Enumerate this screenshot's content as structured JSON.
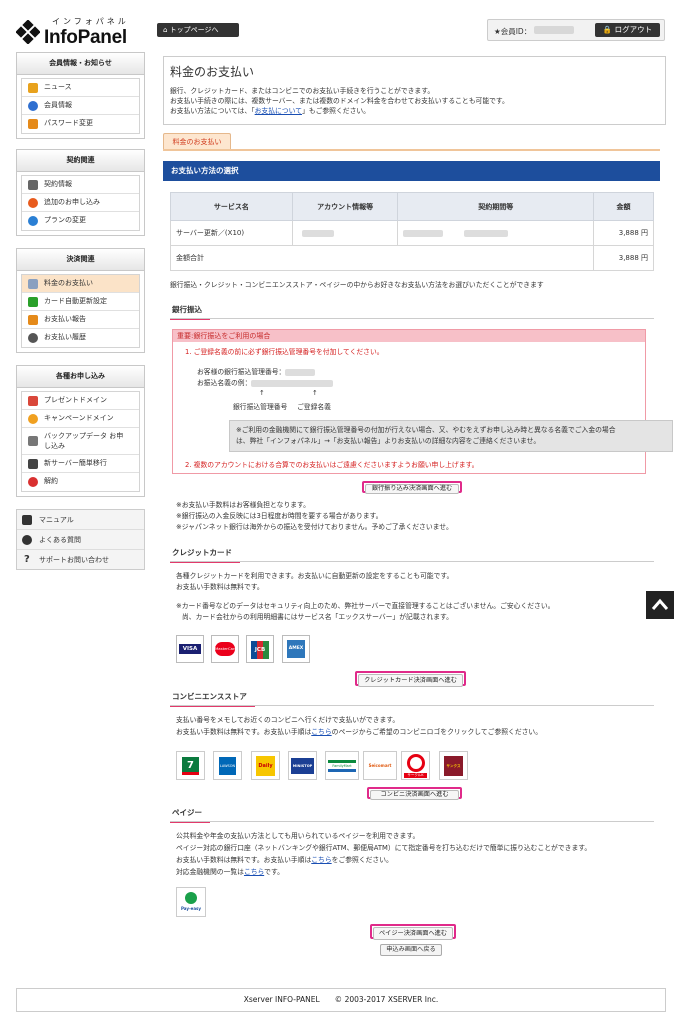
{
  "header": {
    "logo_kana": "インフォパネル",
    "logo_name": "InfoPanel",
    "toppage_button": "トップページへ",
    "member_id_label": "★会員ID：",
    "logout_button": "ログアウト"
  },
  "sidebar": {
    "groups": [
      {
        "title": "会員情報・お知らせ",
        "items": [
          {
            "label": "ニュース",
            "icon": "news-icon",
            "color": "#e8a21d"
          },
          {
            "label": "会員情報",
            "icon": "member-icon",
            "color": "#2f6fd0"
          },
          {
            "label": "パスワード変更",
            "icon": "password-icon",
            "color": "#e58a1a"
          }
        ]
      },
      {
        "title": "契約関連",
        "items": [
          {
            "label": "契約情報",
            "icon": "contract-icon",
            "color": "#666666"
          },
          {
            "label": "追加のお申し込み",
            "icon": "add-icon",
            "color": "#e85b1d"
          },
          {
            "label": "プランの変更",
            "icon": "plan-change-icon",
            "color": "#2a7fd4"
          }
        ]
      },
      {
        "title": "決済関連",
        "items": [
          {
            "label": "料金のお支払い",
            "icon": "payment-icon",
            "color": "#8aa0c0",
            "active": true
          },
          {
            "label": "カード自動更新設定",
            "icon": "card-icon",
            "color": "#2aa02a"
          },
          {
            "label": "お支払い報告",
            "icon": "report-icon",
            "color": "#e58a1a"
          },
          {
            "label": "お支払い履歴",
            "icon": "history-icon",
            "color": "#555555"
          }
        ]
      },
      {
        "title": "各種お申し込み",
        "items": [
          {
            "label": "プレゼントドメイン",
            "icon": "present-icon",
            "color": "#d9473a"
          },
          {
            "label": "キャンペーンドメイン",
            "icon": "campaign-icon",
            "color": "#f0a020"
          },
          {
            "label": "バックアップデータ お申し込み",
            "icon": "backup-icon",
            "color": "#777777"
          },
          {
            "label": "新サーバー簡単移行",
            "icon": "migration-icon",
            "color": "#444444"
          },
          {
            "label": "解約",
            "icon": "cancel-icon",
            "color": "#d93030"
          }
        ]
      }
    ],
    "links": [
      {
        "label": "マニュアル",
        "icon": "manual-icon"
      },
      {
        "label": "よくある質問",
        "icon": "faq-icon"
      },
      {
        "label": "サポートお問い合わせ",
        "icon": "support-icon"
      }
    ]
  },
  "main": {
    "title": "料金のお支払い",
    "intro_line1": "銀行、クレジットカード、またはコンビニでのお支払い手続きを行うことができます。",
    "intro_line2": "お支払い手続きの際には、複数サーバー、または複数のドメイン料金を合わせてお支払いすることも可能です。",
    "intro_line3_pre": "お支払い方法については、「",
    "intro_link": "お支払について",
    "intro_line3_post": "」もご参照ください。",
    "tab": "料金のお支払い",
    "section_bar": "お支払い方法の選択",
    "table": {
      "headers": [
        "サービス名",
        "アカウント情報等",
        "契約期間等",
        "金額"
      ],
      "row_service": "サーバー更新／(X10)",
      "row_amount": "3,888 円",
      "total_label": "金額合計",
      "total_amount": "3,888 円"
    },
    "select_text": "銀行振込・クレジット・コンビニエンスストア・ペイジーの中からお好きなお支払い方法をお選びいただくことができます",
    "bank": {
      "title": "銀行振込",
      "notice_head": "重要:銀行振込をご利用の場合",
      "item1": "1. ご登録名義の前に必ず銀行振込管理番号を付加してください。",
      "mgmt_label": "お客様の銀行振込管理番号：",
      "example_label": "お振込名義の例：",
      "arrow": "↑",
      "label_mgmt": "銀行振込管理番号",
      "label_name": "ご登録名義",
      "gray_line1": "※ご利用の金融機関にて銀行振込管理番号の付加が行えない場合、又、やむをえずお申し込み時と異なる名義でご入金の場合",
      "gray_line2": "は、弊社「インフォパネル」→「お支払い報告」よりお支払いの詳細な内容をご連絡くださいませ。",
      "item2": "2. 複数のアカウントにおける合算でのお支払いはご遠慮くださいますようお願い申し上げます。",
      "button": "銀行振り込み決済画面へ進む",
      "note1": "※お支払い手数料はお客様負担となります。",
      "note2": "※銀行振込の入金反映には3日程度お時間を要する場合があります。",
      "note3": "※ジャパンネット銀行は海外からの振込を受付けておりません。予めご了承くださいませ。"
    },
    "credit": {
      "title": "クレジットカード",
      "line1": "各種クレジットカードを利用できます。お支払いに自動更新の設定をすることも可能です。",
      "line2": "お支払い手数料は無料です。",
      "line3": "※カード番号などのデータはセキュリティ向上のため、弊社サーバーで直接管理することはございません。ご安心ください。",
      "line4": "尚、カード会社からの利用明細書にはサービス名「エックスサーバー」が記載されます。",
      "cards": [
        "VISA",
        "MasterCard",
        "JCB",
        "AMEX"
      ],
      "button": "クレジットカード決済画面へ進む"
    },
    "convenience": {
      "title": "コンビニエンスストア",
      "line1": "支払い番号をメモしてお近くのコンビニへ行くだけで支払いができます。",
      "line2_pre": "お支払い手数料は無料です。お支払い手順は",
      "link": "こちら",
      "line2_post": "のページからご希望のコンビニロゴをクリックしてご参照ください。",
      "stores": [
        "7",
        "LAWSON",
        "Daily",
        "MINISTOP",
        "FamilyMart",
        "Seicomart",
        "サークルK",
        "サンクス"
      ],
      "button": "コンビニ決済画面へ進む"
    },
    "payeasy": {
      "title": "ペイジー",
      "line1": "公共料金や年金の支払い方法としても用いられているペイジーを利用できます。",
      "line2": "ペイジー対応の銀行口座（ネットバンキングや銀行ATM、郵便局ATM）にて指定番号を打ち込むだけで簡単に振り込むことができます。",
      "line3_pre": "お支払い手数料は無料です。お支払い手順は",
      "link1": "こちら",
      "line3_post": "をご参照ください。",
      "line4_pre": "対応金融機関の一覧は",
      "link2": "こちら",
      "line4_post": "です。",
      "logo_text": "Pay-easy",
      "button": "ペイジー決済画面へ進む"
    },
    "back_button": "申込み画面へ戻る"
  },
  "footer": {
    "text": "Xserver INFO-PANEL　　© 2003-2017 XSERVER Inc."
  }
}
